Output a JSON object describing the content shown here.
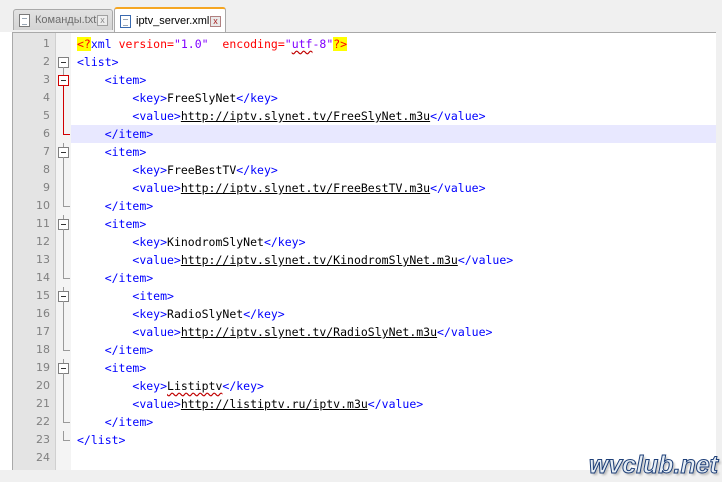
{
  "tabs": [
    {
      "label": "Команды.txt",
      "active": false,
      "close_label": "x"
    },
    {
      "label": "iptv_server.xml",
      "active": true,
      "close_label": "x"
    }
  ],
  "editor": {
    "current_line": 6,
    "lines": [
      {
        "n": "1"
      },
      {
        "n": "2"
      },
      {
        "n": "3"
      },
      {
        "n": "4"
      },
      {
        "n": "5"
      },
      {
        "n": "6"
      },
      {
        "n": "7"
      },
      {
        "n": "8"
      },
      {
        "n": "9"
      },
      {
        "n": "10"
      },
      {
        "n": "11"
      },
      {
        "n": "12"
      },
      {
        "n": "13"
      },
      {
        "n": "14"
      },
      {
        "n": "15"
      },
      {
        "n": "16"
      },
      {
        "n": "17"
      },
      {
        "n": "18"
      },
      {
        "n": "19"
      },
      {
        "n": "20"
      },
      {
        "n": "21"
      },
      {
        "n": "22"
      },
      {
        "n": "23"
      },
      {
        "n": "24"
      }
    ],
    "tokens": {
      "l1_open": "<?",
      "l1_xml": "xml",
      "l1_version_attr": " version=",
      "l1_version_val": "\"1.0\"",
      "l1_enc_attr": "  encoding=",
      "l1_enc_q1": "\"",
      "l1_enc_val": "utf",
      "l1_enc_rest": "-8\"",
      "l1_close": "?>",
      "list_open": "<list>",
      "list_close": "</list>",
      "item_open": "<item>",
      "item_close": "</item>",
      "key_open": "<key>",
      "key_close": "</key>",
      "value_open": "<value>",
      "value_close": "</value>"
    },
    "items": [
      {
        "key": "FreeSlyNet",
        "value": "http://iptv.slynet.tv/FreeSlyNet.m3u"
      },
      {
        "key": "FreeBestTV",
        "value": "http://iptv.slynet.tv/FreeBestTV.m3u"
      },
      {
        "key": "KinodromSlyNet",
        "value": "http://iptv.slynet.tv/KinodromSlyNet.m3u"
      },
      {
        "key": "RadioSlyNet",
        "value": "http://iptv.slynet.tv/RadioSlyNet.m3u"
      },
      {
        "key": "Listiptv",
        "value": "http://listiptv.ru/iptv.m3u"
      }
    ]
  },
  "colors": {
    "tag": "#0000ff",
    "attr": "#ff0000",
    "string": "#8000ff",
    "processing_instruction_bg": "#ffff00",
    "current_line_bg": "#e8e8ff",
    "gutter_bg": "#e4e4e4",
    "active_tab_accent": "#f5a623"
  },
  "watermark": "wvclub.net"
}
